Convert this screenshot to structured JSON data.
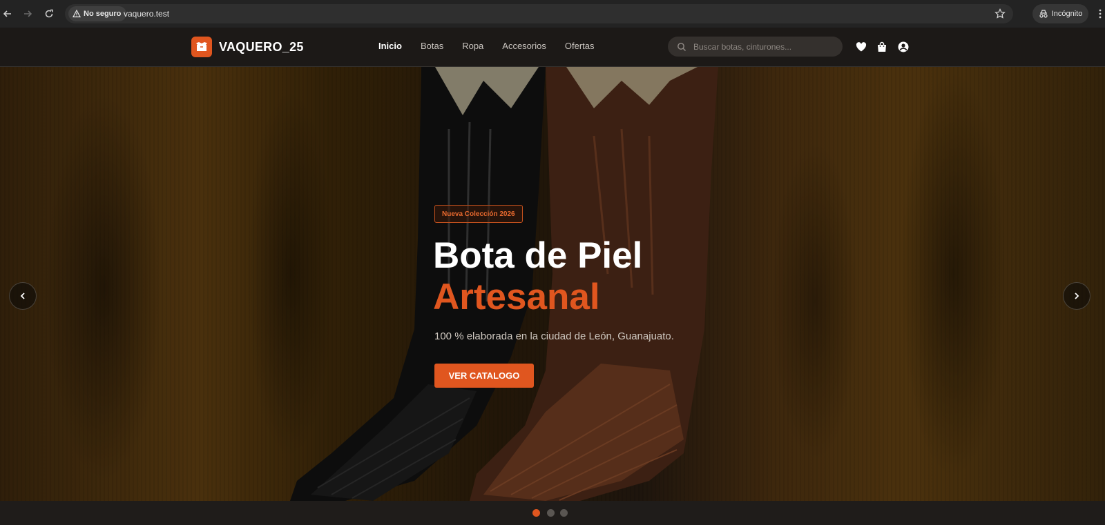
{
  "browser": {
    "security_label": "No seguro",
    "url": "vaquero.test",
    "incognito_label": "Incógnito"
  },
  "site": {
    "brand": "VAQUERO_25",
    "brand_color": "#e0561f",
    "nav": [
      {
        "label": "Inicio",
        "active": true
      },
      {
        "label": "Botas",
        "active": false
      },
      {
        "label": "Ropa",
        "active": false
      },
      {
        "label": "Accesorios",
        "active": false
      },
      {
        "label": "Ofertas",
        "active": false
      }
    ],
    "search_placeholder": "Buscar botas, cinturones...",
    "header_icons": [
      "heart-icon",
      "shopping-bag-icon",
      "user-icon"
    ]
  },
  "hero": {
    "badge": "Nueva Colección 2026",
    "title_line1": "Bota de Piel",
    "title_line2": "Artesanal",
    "subtitle": "100 % elaborada en la ciudad de León, Guanajuato.",
    "cta": "VER CATALOGO",
    "slide_count": 3,
    "active_slide": 1
  }
}
